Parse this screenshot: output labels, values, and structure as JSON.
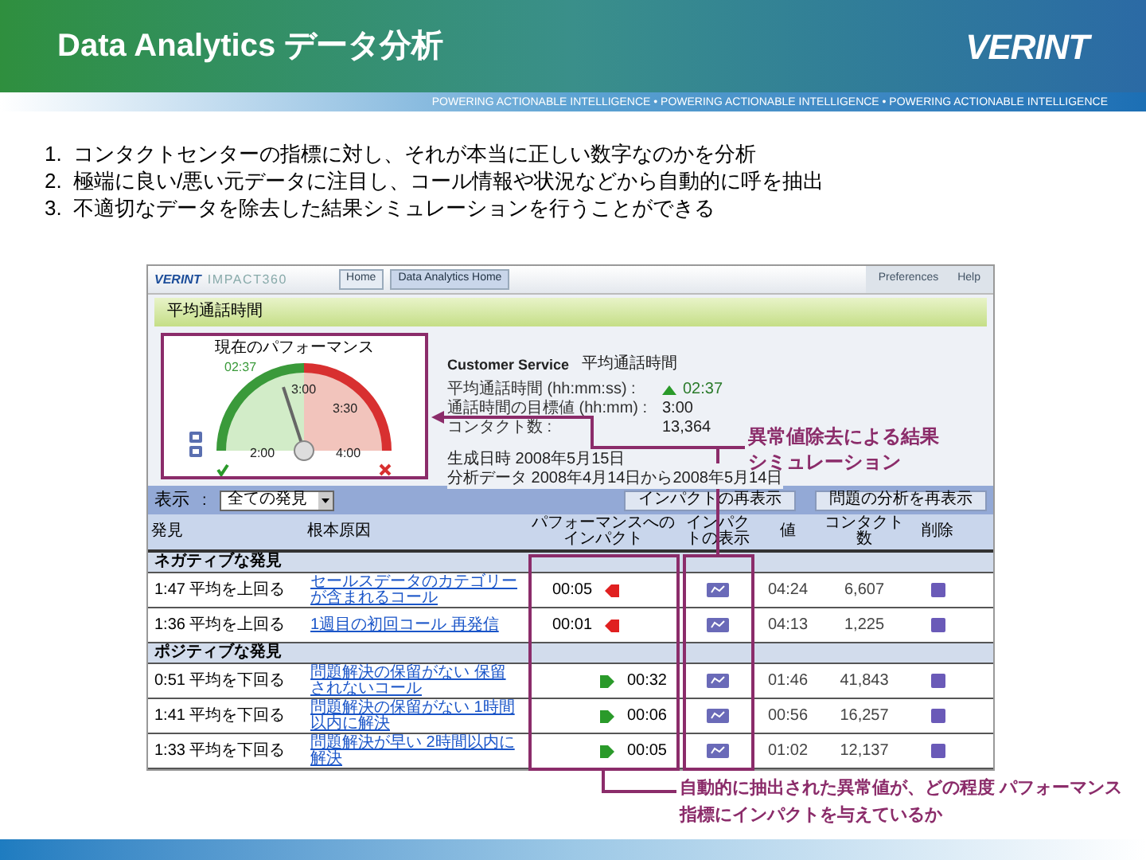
{
  "header": {
    "title": "Data Analytics データ分析",
    "logo": "VERINT",
    "tagline": "POWERING ACTIONABLE INTELLIGENCE • POWERING ACTIONABLE INTELLIGENCE • POWERING ACTIONABLE INTELLIGENCE"
  },
  "bullets": [
    {
      "number": "1.",
      "text": "コンタクトセンターの指標に対し、それが本当に正しい数字なのかを分析"
    },
    {
      "number": "2.",
      "text": "極端に良い/悪い元データに注目し、コール情報や状況などから自動的に呼を抽出"
    },
    {
      "number": "3.",
      "text": "不適切なデータを除去した結果シミュレーションを行うことができる"
    }
  ],
  "app": {
    "logo": "VERINT",
    "product": "IMPACT360",
    "tabs": [
      {
        "label": "Home",
        "selected": false
      },
      {
        "label": "Data Analytics Home",
        "selected": true
      }
    ],
    "links": [
      "Preferences",
      "Help"
    ],
    "page_title": "平均通話時間",
    "gauge": {
      "title": "現在のパフォーマンス",
      "labels": [
        "02:37",
        "3:00",
        "3:30",
        "2:00",
        "4:00"
      ],
      "level": 0.4
    },
    "summary": {
      "heading": "Customer Service",
      "subheading": "平均通話時間",
      "metrics": [
        {
          "label": "平均通話時間 (hh:mm:ss) :",
          "value": "02:37",
          "trend_up": true
        },
        {
          "label": "通話時間の目標値 (hh:mm) :",
          "value": "3:00",
          "trend_up": false
        },
        {
          "label": "コンタクト数 :",
          "value": "13,364",
          "trend_up": false
        }
      ],
      "generated": "生成日時 2008年5月15日",
      "period": "分析データ 2008年4月14日から2008年5月14日"
    },
    "filter": {
      "label": "表示",
      "separator": ":",
      "value": "全ての発見"
    },
    "buttons": [
      "インパクトの再表示",
      "問題の分析を再表示"
    ],
    "columns": [
      "発見",
      "根本原因",
      "パフォーマンスへのインパクト",
      "インパクトの表示",
      "値",
      "コンタクト数",
      "削除"
    ],
    "groups": [
      {
        "title": "ネガティブな発見",
        "rows": [
          {
            "finding": "1:47 平均を上回る",
            "cause": "セールスデータのカテゴリーが含まれるコール",
            "impact": "00:05",
            "positive": false,
            "value": "04:24",
            "contacts": "6,607"
          },
          {
            "finding": "1:36 平均を上回る",
            "cause": "1週目の初回コール 再発信",
            "impact": "00:01",
            "positive": false,
            "value": "04:13",
            "contacts": "1,225"
          }
        ]
      },
      {
        "title": "ポジティブな発見",
        "rows": [
          {
            "finding": "0:51 平均を下回る",
            "cause": "問題解決の保留がない 保留されないコール",
            "impact": "00:32",
            "positive": true,
            "value": "01:46",
            "contacts": "41,843"
          },
          {
            "finding": "1:41 平均を下回る",
            "cause": "問題解決の保留がない 1時間以内に解決",
            "impact": "00:06",
            "positive": true,
            "value": "00:56",
            "contacts": "16,257"
          },
          {
            "finding": "1:33 平均を下回る",
            "cause": "問題解決が早い 2時間以内に解決",
            "impact": "00:05",
            "positive": true,
            "value": "01:02",
            "contacts": "12,137"
          }
        ]
      }
    ]
  },
  "annotations": [
    "異常値除去による結果シミュレーション",
    "自動的に抽出された異常値が、どの程度 パフォーマンス指標にインパクトを与えているか"
  ]
}
